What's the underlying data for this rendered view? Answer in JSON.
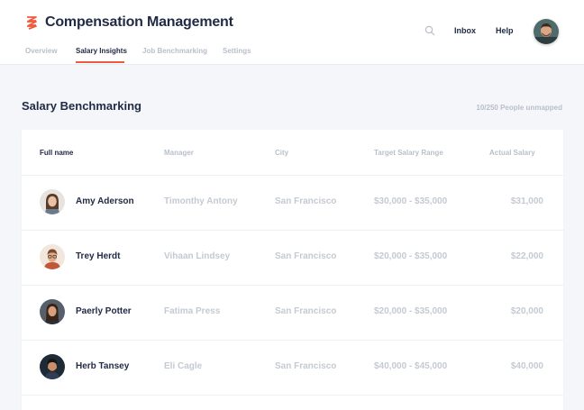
{
  "header": {
    "title": "Compensation Management",
    "tabs": [
      "Overview",
      "Salary Insights",
      "Job Benchmarking",
      "Settings"
    ],
    "active_tab": "Salary Insights",
    "inbox_label": "Inbox",
    "help_label": "Help",
    "logo_icon": "stacked-chevron-logo-icon",
    "search_icon": "search-icon",
    "accent_color": "#f05a3c"
  },
  "main": {
    "section_title": "Salary Benchmarking",
    "unmapped_text": "10/250 People unmapped",
    "table": {
      "columns": [
        "Full name",
        "Manager",
        "City",
        "Target Salary Range",
        "Actual Salary"
      ],
      "rows": [
        {
          "name": "Amy Aderson",
          "manager": "Timonthy Antony",
          "city": "San Francisco",
          "range": "$30,000 - $35,000",
          "actual": "$31,000"
        },
        {
          "name": "Trey Herdt",
          "manager": "Vihaan Lindsey",
          "city": "San Francisco",
          "range": "$20,000 - $35,000",
          "actual": "$22,000"
        },
        {
          "name": "Paerly Potter",
          "manager": "Fatima Press",
          "city": "San Francisco",
          "range": "$20,000 - $35,000",
          "actual": "$20,000"
        },
        {
          "name": "Herb Tansey",
          "manager": "Eli Cagle",
          "city": "San Francisco",
          "range": "$40,000 - $45,000",
          "actual": "$40,000"
        }
      ]
    }
  }
}
